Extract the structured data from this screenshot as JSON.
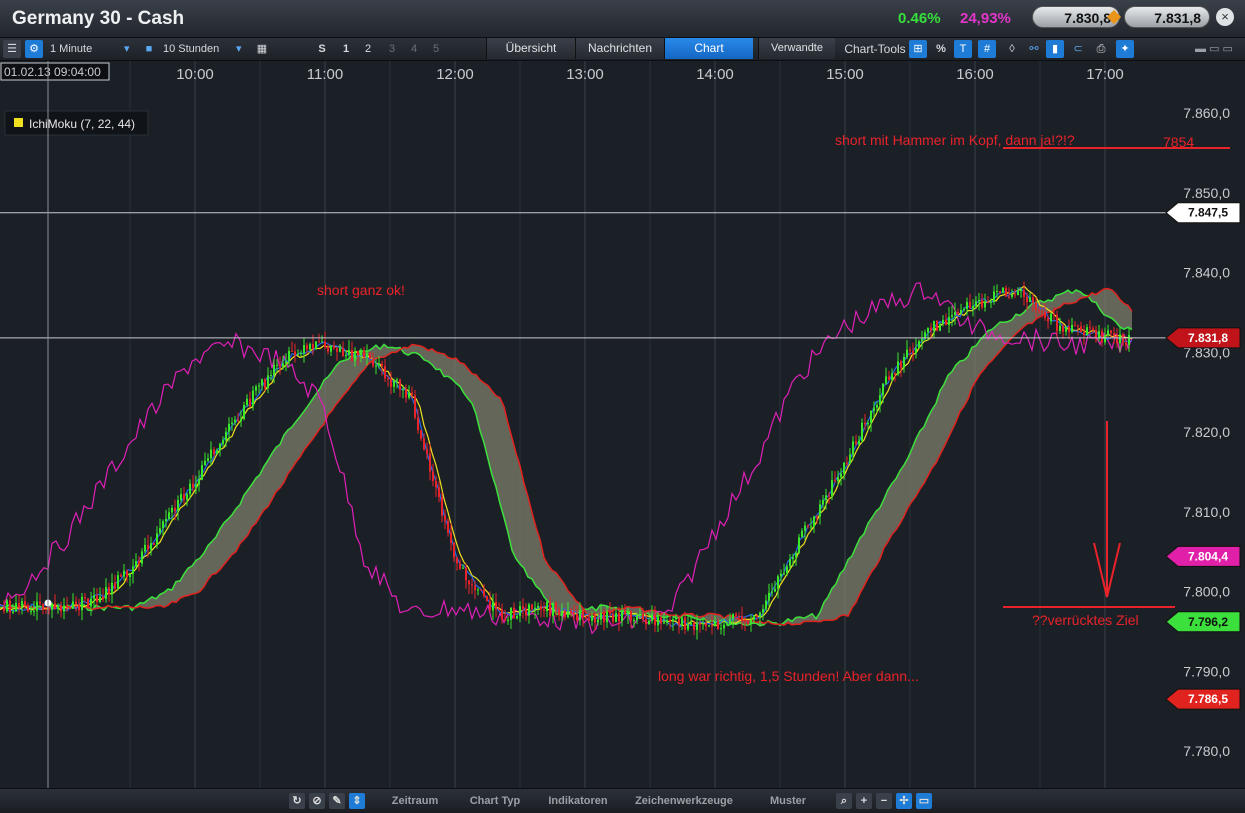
{
  "window": {
    "title": "Germany 30 - Cash",
    "change_pct": "0.46%",
    "sentiment_pct": "24,93%",
    "bid": "7.830,8",
    "ask": "7.831,8",
    "close_label": "×"
  },
  "toolbar": {
    "interval": "1 Minute",
    "range": "10 Stunden",
    "chart_count": [
      "S",
      "1",
      "2",
      "3",
      "4",
      "5"
    ],
    "tabs": [
      "Übersicht",
      "Nachrichten",
      "Chart"
    ],
    "active_tab": "Chart",
    "related": "Verwandte",
    "chart_tools": "Chart-Tools",
    "percent": "%"
  },
  "bottom_toolbar": [
    "Zeitraum",
    "Chart Typ",
    "Indikatoren",
    "Zeichenwerkzeuge",
    "Muster"
  ],
  "colors": {
    "candle_up": "#38e82a",
    "candle_down": "#e8232a",
    "accent": "#1e7bd6",
    "cloud": "#7f7f6c",
    "senkou_a": "#3ce03c",
    "senkou_b": "#e0231e",
    "tenkan": "#f0e020",
    "kijun": "#2468e8",
    "chikou": "#e020b8"
  },
  "chart_data": {
    "type": "line",
    "timestamp_label": "01.02.13 09:04:00",
    "x_ticks": [
      "10:00",
      "11:00",
      "12:00",
      "13:00",
      "14:00",
      "15:00",
      "16:00",
      "17:00"
    ],
    "y_ticks": [
      "7.860,0",
      "7.850,0",
      "7.840,0",
      "7.830,0",
      "7.820,0",
      "7.810,0",
      "7.800,0",
      "7.790,0",
      "7.780,0"
    ],
    "ylim": [
      7775,
      7866
    ],
    "indicator_legend": "IchiMoku (7, 22, 44)",
    "series": [
      {
        "name": "IchiMoku (7, 22, 44)",
        "x": [
          "09:04",
          "09:20",
          "09:40",
          "10:00",
          "10:20",
          "10:40",
          "11:00",
          "11:20",
          "11:40",
          "12:00",
          "12:20",
          "12:40",
          "13:00",
          "13:20",
          "13:40",
          "14:00",
          "14:20",
          "14:40",
          "15:00",
          "15:20",
          "15:40",
          "16:00",
          "16:20",
          "16:40",
          "17:00",
          "17:20"
        ],
        "values": [
          7798,
          7800,
          7806,
          7814,
          7822,
          7829,
          7831,
          7829,
          7824,
          7804,
          7797,
          7798,
          7797,
          7797,
          7796,
          7796,
          7797,
          7807,
          7816,
          7827,
          7833,
          7836,
          7838,
          7833,
          7832,
          7831
        ]
      }
    ],
    "h_lines": [
      7847.5,
      7831.8
    ],
    "price_tags": [
      {
        "label": "7.847,5",
        "value": 7847.5,
        "color": "#ffffff",
        "text_color": "#111111"
      },
      {
        "label": "7.831,8",
        "value": 7831.8,
        "color": "#c0141a",
        "text_color": "#ffffff"
      },
      {
        "label": "7.804,4",
        "value": 7804.4,
        "color": "#e020a8",
        "text_color": "#ffffff"
      },
      {
        "label": "7.796,2",
        "value": 7796.2,
        "color": "#3ce03c",
        "text_color": "#111111"
      },
      {
        "label": "7.786,5",
        "value": 7786.5,
        "color": "#e0231e",
        "text_color": "#ffffff"
      }
    ],
    "annotations": [
      {
        "text": "short mit Hammer im Kopf, dann ja!?!?"
      },
      {
        "text": "7854"
      },
      {
        "text": "short ganz ok!"
      },
      {
        "text": "long war richtig, 1,5 Stunden! Aber dann..."
      },
      {
        "text": "??verrücktes Ziel"
      }
    ]
  }
}
